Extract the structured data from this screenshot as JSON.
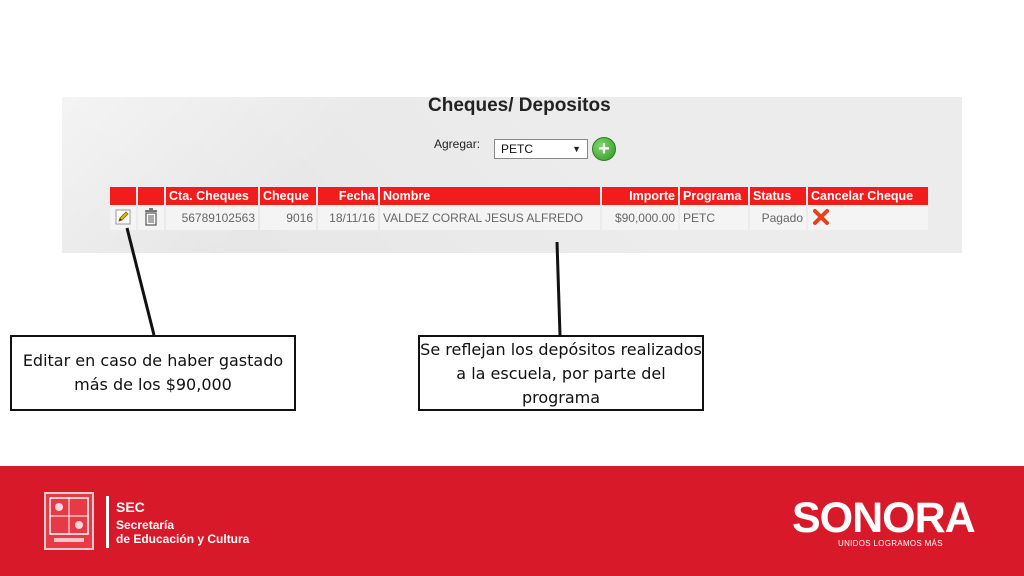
{
  "panel": {
    "title": "Cheques/ Depositos",
    "add_label": "Agregar:",
    "program_select_value": "PETC",
    "add_button_label": "+"
  },
  "table": {
    "headers": [
      "",
      "",
      "Cta. Cheques",
      "Cheque",
      "Fecha",
      "Nombre",
      "Importe",
      "Programa",
      "Status",
      "Cancelar Cheque"
    ],
    "rows": [
      {
        "cta_cheques": "56789102563",
        "cheque": "9016",
        "fecha": "18/11/16",
        "nombre": "VALDEZ CORRAL JESUS ALFREDO",
        "importe": "$90,000.00",
        "programa": "PETC",
        "status": "Pagado"
      }
    ]
  },
  "callouts": {
    "left": "Editar en caso de haber gastado más de los $90,000",
    "right": "Se reflejan los depósitos realizados a la escuela, por parte del programa"
  },
  "footer": {
    "sec_abbr": "SEC",
    "sec_line1": "Secretaría",
    "sec_line2": "de Educación y Cultura",
    "brand": "SONORA",
    "slogan": "UNIDOS LOGRAMOS MÁS"
  },
  "icons": {
    "edit": "pencil-icon",
    "delete": "trash-icon",
    "cancel": "red-x-icon",
    "add": "green-plus-icon",
    "dropdown": "triangle-down-icon"
  },
  "colors": {
    "header_red": "#f21c1c",
    "footer_red": "#d8192a",
    "add_green": "#2f9a22"
  }
}
